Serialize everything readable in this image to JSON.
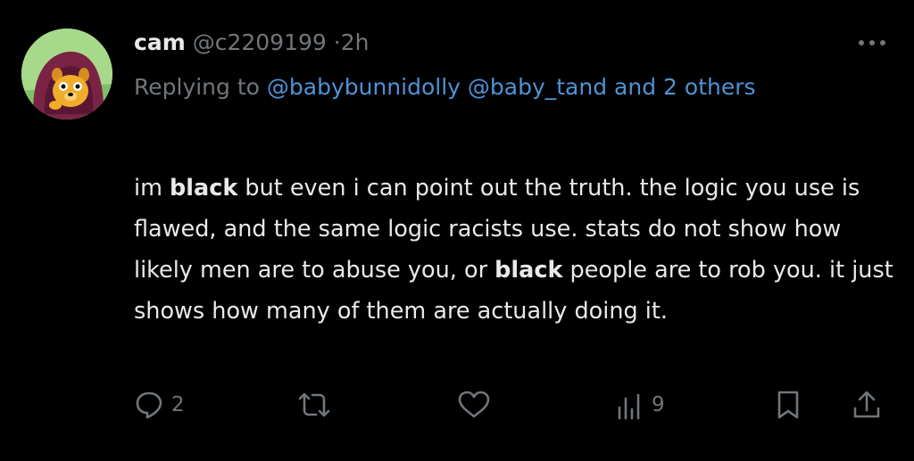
{
  "tweet": {
    "name": "cam",
    "handle": "@c2209199",
    "separator": "·",
    "time": "2h",
    "reply_prefix": "Replying to ",
    "mention_1": "@babybunnidolly",
    "mention_2": "@baby_tand",
    "reply_and": " and ",
    "reply_others": "2 others",
    "text_1": "im ",
    "text_bold_1": "black",
    "text_2": " but even i can point out the truth. the logic you use is flawed, and the same logic racists use. stats do not show how likely men are to abuse you, or ",
    "text_bold_2": "black",
    "text_3": " people are to rob you. it just shows how many of them are actually doing it."
  },
  "actions": {
    "reply_count": "2",
    "retweet_count": "",
    "like_count": "",
    "views_count": "9"
  },
  "icons": {
    "more": "more-horizontal-icon",
    "reply": "reply-bubble-icon",
    "retweet": "retweet-icon",
    "like": "heart-icon",
    "views": "views-bar-chart-icon",
    "bookmark": "bookmark-icon",
    "share": "share-upload-icon"
  },
  "colors": {
    "background": "#000000",
    "text": "#e7e9ea",
    "muted": "#71767b",
    "link": "#4e93d6"
  }
}
